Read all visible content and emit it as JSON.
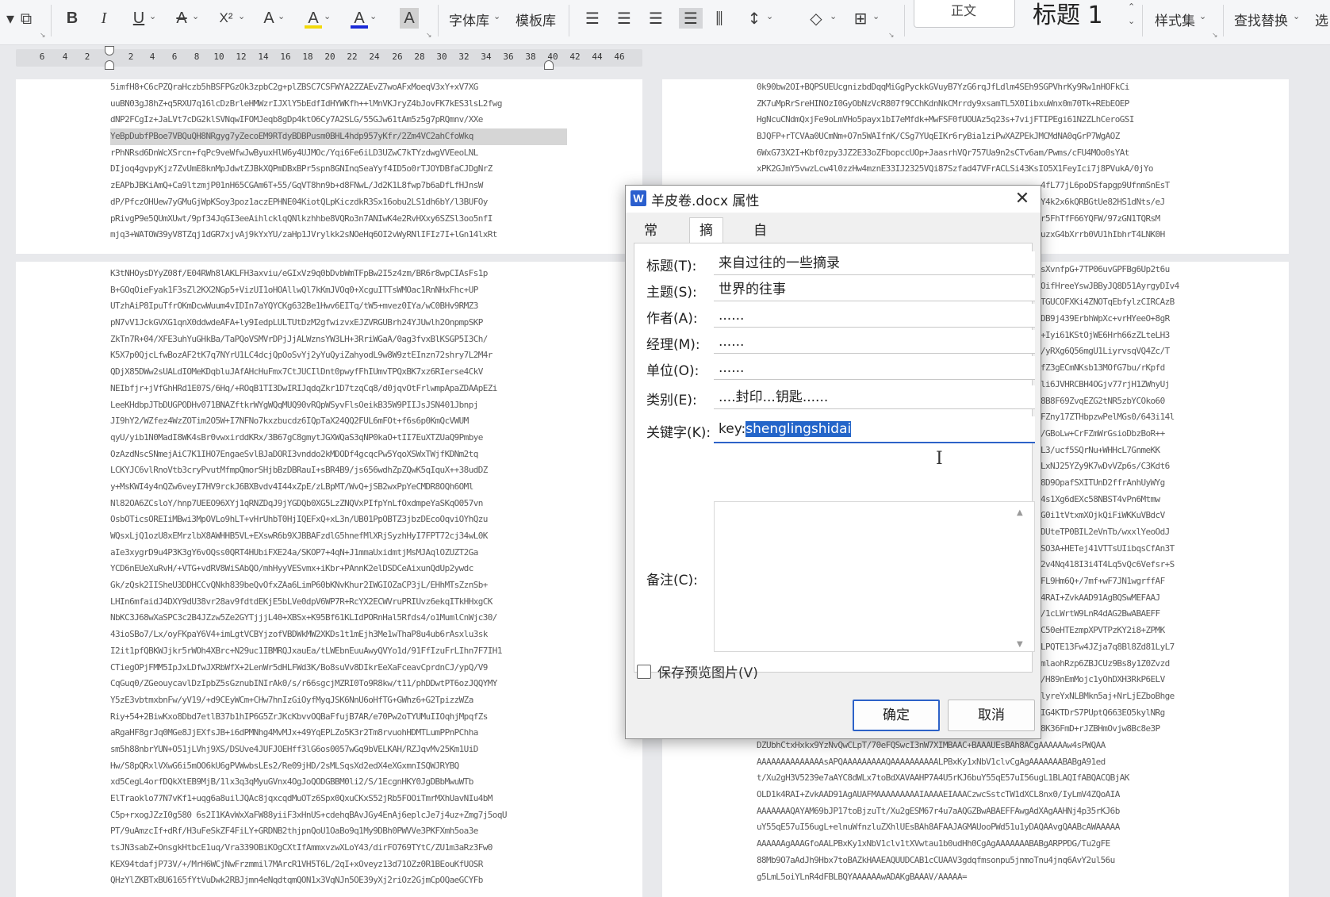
{
  "ribbon": {
    "bold": "B",
    "italic": "I",
    "underline": "U",
    "strikethrough": "A",
    "superscript": "X²",
    "font_effect": "A",
    "highlight": "A",
    "font_color": "A",
    "char_shading": "A",
    "font_library": "字体库",
    "template_library": "模板库",
    "style_normal": "正文",
    "style_heading": "标题 1",
    "style_set": "样式集",
    "find_replace": "查找替换",
    "select": "选"
  },
  "ruler": {
    "ticks": [
      "6",
      "4",
      "2",
      "2",
      "4",
      "6",
      "8",
      "10",
      "12",
      "14",
      "16",
      "18",
      "20",
      "22",
      "24",
      "26",
      "28",
      "30",
      "32",
      "34",
      "36",
      "38",
      "40",
      "42",
      "44",
      "46"
    ]
  },
  "left_page_top": [
    "5imfH8+C6cPZQraHczb5hBSFPGzOk3zpbC2g+plZBSC7CSFWYA2ZZAEvZ7woAFxMoeqV3xY+xV7XG",
    "uuBN03gJ8hZ+q5RXU7q16lcDzBrleHMWzrIJXlY5bEdfIdHYWKfh++lMnVKJryZ4bJovFK7kES3lsL2fwg",
    "dNP2FCgIz+JaLVt7cDG2klSVNqwIFOMJeqb8gDp4ktO6Cy7A2SLG/55GJw61tAm5z5g7pRQmnv/XXe",
    "YeBpDubfPBoe7VBQuQH8NRgyg7yZecoEM9RTdyBDBPusm0BHL4hdp957yKfr/2Zm4VC2ahCfoWkq",
    "rPhNRsd6DnWcXSrcn+fqPc9veWfwJwByuxHlW6y4UJMOc/Yqi6Fe6iLD3UZwC7kTYzdwgVVEeoLNL",
    "DIjoq4gvpyKjz7ZvUmE8knMpJdwtZJBkXQPmDBxBPr5spn8GNInqSeaYyf4ID5o0rTJOYDBfaCJDgNrZ",
    "zEAPbJBKiAmQ+Ca9ltzmjP01nH65CGAm6T+55/GqVT8hn9b+d8FNwL/Jd2K1L8fwp7b6aDfLfHJnsW",
    "dP/PfczOHUew7yGMuGjWpKSoy3poz1aczEPHNE04KiotQLpKiczdkR3Sx16obu2LS1dh6bY/l3BUFOy",
    "pRivgP9e5QUmXUwt/9pf34JqGI3eeAihlcklqQNlkzhhbe8VQRo3n7ANIwK4e2RvHXxy6SZSl3oo5nfI",
    "mjq3+WATOW39yV8TZqj1dGR7xjvAj9kYxYU/zaHp1JVrylkk2sNOeHq6OI2vWyRNlIFIz7I+lGn14lxRt"
  ],
  "left_page_bottom": [
    "K3tNHOysDYyZ08f/E04RWh8lAKLFH3axviu/eGIxVz9q0bDvbWmTFpBw2I5z4zm/BR6r8wpCIAsFs1p",
    "B+GOqOieFyak1F3sZl2KX2NGp5+VizUI1oHOAllwQl7kKmJVOq0+XcguITTsWMOac1RnNHxFhc+UP",
    "UTzhAiP8IpuTfrOKmDcwWuum4vIDIn7aYQYCKg632Be1Hwv6EITq/tW5+mvez0IYa/wC0BHv9RMZ3",
    "pN7vV1JckGVXG1qnX0ddwdeAFA+ly9IedpLULTUtDzM2gfwizvxEJZVRGUBrh24YJUwlh2OnpmpSKP",
    "ZkTn7R+04/XFE3uhYuGHkBa/TaPQoVSMVrDPjJjALWznsYW3LH+3RriWGaA/0ag3fvxBlKSGP5I3Ch/",
    "K5X7p0QjcLfwBozAF2tK7q7NYrU1LC4dcjQpOoSvYj2yYuQyiZahyodL9w8W9ztEInzn72shry7L2M4r",
    "QDjX85DWw2sUALdIOMeKDqbluJAfAHcHuFmx7CtJUCIlDnt0pwyfFhIUmvTPQxBK7xz6RIerse4CkV",
    "NEIbfjr+jVfGhHRd1E07S/6Hq/+ROqB1TI3DwIRIJqdqZkr1D7tzqCq8/d0jqvOtFrlwmpApaZDAApEZi",
    "LeeKHdbpJTbDUGPODHv071BNAZftkrWYgWQqMUQ90vRQpWSyvFlsOeikB35W9PIIJsJSN401Jbnpj",
    "JI9hY2/WZfez4WzZOTim2O5W+I7NFNo7kxzbucdz6IQpTaX24QQ2FUL6mFOt+f6s6p0KmQcVWUM",
    "qyU/yib1N0MadI8WK4sBr0vwxirddKRx/3B67gC8gmytJGXWQaS3qNP0kaO+tII7EuXTZUaQ9Pmbye",
    "OzAzdNscSNmejAiC7K1IHO7EngaeSvlBJaDORI3vnddo2kMDODf4gcqcPw5YqoXSWxTWjfKDNm2tq",
    "LCKYJC6vlRnoVtb3cryPvutMfmpQmorSHjbBzDBRauI+sBR4B9/js656wdhZpZQwK5qIquX++38udDZ",
    "y+MsKWI4y4nQZw6veyI7HV9rckJ6BXBvdv4I44xZpE/zLBpMT/WvQ+jSB2wxPpYeCMDR8OQh6OMl",
    "Nl82OA6ZCsloY/hnp7UEEO96XYj1qRNZDqJ9jYGDQb0XG5LzZNQVxPIfpYnLfOxdmpeYaSKqO057vn",
    "OsbOTicsOREIiMBwi3MpOVLo9hLT+vHrUhbT0HjIQEFxQ+xL3n/UB01PpOBTZ3jbzDEcoOqviOYhQzu",
    "WQsxLjQ1ozU8xEMrzlbX8AWHHB5VL+EXswR6b9XJBBAFzdlG5hnefMlXRjSyzhHyI7FPT72cj34wL0K",
    "aIe3xygrD9u4P3K3gY6vOQss0QRT4HUbiFXE24a/SKOP7+4qN+J1mmaUxidmtjMsMJAqlOZUZT2Ga",
    "YCD6nEUeXuRvH/+VTG+vdRV8WiSAbQO/mhHyyVESvmx+iKbr+PAnnK2elDSDCeAixunQdUp2ywdc",
    "Gk/zQsk2IISheU3DDHCCvQNkh839beQvOfxZAa6LimP60bKNvKhur2IWGIOZaCP3jL/EHhMTsZznSb+",
    "LHIn6mfaidJ4DXY9dU38vr28av9fdtdEKjE5bLVe0dpV6WP7R+RcYX2ECWVruPRIUvz6ekqITkHHxgCK",
    "NbKC3J68wXaSPC3c2B4JZzw5Ze2GYTjjjL40+XBSx+K95Bf61KLIdPORnHal5Rfds4/o1MumlCnWjc30/",
    "43ioSBo7/Lx/oyFKpaY6V4+imLgtVCBYjzofVBDWkMW2XKDs1t1mEjh3Me1wThaP8u4ub6rAsxlu3sk",
    "I2it1pfQBKWJjkr5rWOh4XBrc+N29uc1IBMRQJxauEa/tLWEbnEuuAwyQVYo1d/91FfIzuFrLIhn7F7IH1",
    "CTiegOPjFMM5IpJxLDfwJXRbWfX+2LenWr5dHLFWd3K/Bo8suVv8DIkrEeXaFceavCprdnCJ/ypQ/V9",
    "CqGuq0/ZGeouycavlDzIpbZ5sGznubINIrAk0/s/r66sgcjMZRI0To9R8kw/t11/phDDwtPT6ozJQQYMY",
    "Y5zE3vbtmxbnFw/yV19/+d9CEyWCm+CHw7hnIzGiOyfMyqJSK6NnU6oHfTG+GWhz6+G2TpizzWZa",
    "Riy+54+2BiwKxo8Dbd7etlB37b1hIP6G5ZrJKcKbvvOQBaFfujB7AR/e70Pw2oTYUMuIIOqhjMpqfZs",
    "aRgaHF8grJq0MGe8JjEXfsJB+i6dPMNhg4MvMJx+49YqEPLZo5K3r2Tm8rvuohHDMTLumPPnPChha",
    "sm5h88nbrYUN+O51jLVhj9XS/DSUve4JUFJOEHff3lG6os0057wGq9bVELKAH/RZJqvMv25Km1UiD",
    "Hw/S8pQRxlVXwG6i5mOO6kU6gPVWwbsLEs2/Re09jHD/2sMLSqsXd2edX4eXGxmnISQWJRYBQ",
    "xd5CegL4orfDQkXtEB9MjB/1lx3q3qMyuGVnx4OgJoQODGBBM0li2/S/1EcgnHKY0JgDBbMwuWTb",
    "ElTraoklo77N7vKf1+uqg6a8uilJQAc8jqxcqdMuOTz6Spx0QxuCKxS52jRb5FOOiTmrMXhUavNIu4bM",
    "C5p+rxogJZzI0g580 6s2I1KAvWxXaFW88yiiF3xHnUS+cdehqBAvJGy4EnAj6eplcJe7j4uz+Zmg7j5oqU",
    "PT/9uAmzcIf+dRf/H3uFeSkZF4FiLY+GRDNB2thjpnQoU1OaBo9q1My9DBh0PWVVe3PKFXmh5oa3e",
    "tsJN3sabZ+OnsgkHtbcE1uq/Vra339OBiKOgCXtIfAmmxvzwXLoY43/dirFO769TYtC/ZU1m3aRz3Fw0",
    "KEX94tdafjP73V/+/MrH6WCjNwFrzmmil7MArcR1VH5T6L/2qI+xOveyz13d71OZz0R1BEouKfUOSR",
    "QHzYlZKBTxBU6165fYtVuDwk2RBJjmn4eNqdtqmQON1x3VqNJn5OE39yXj2riOz2GjmCpOQaeGCYFb"
  ],
  "right_page_top": [
    "0k90bw2OI+BQPSUEUcgnizbdDqqMiGgPyckkGVuyB7YzG6rqJfLdlm4SEh9SGPVhrKy9Rw1nHOFkCi",
    "ZK7uMpRrSreHINOzI0GyObNzVcR807f9CChKdnNkCMrrdy9xsamTL5X0IibxuWnx0m70Tk+REbEOEP",
    "HgNcuCNdmQxjFe9oLmVHo5payx1bI7eMfdk+MwFSF0fUOUAz5q23s+7vijFTIPEgi61N2ZLhCeroGSI",
    "BJQFP+rTCVAa0UCmNm+O7n5WAIfnK/CSg7YUqEIKr6ryBia1ziPwXAZPEkJMCMdNA0qGrP7WgAOZ",
    "6WxG73X2I+Kbf0zpy3JZ2E33oZFbopccUOp+JaasrhVQr757Ua9n2sCTv6am/Pwms/cFU4MOo0sYAt",
    "xPK2GJmY5vwzLcw4l0zzHw4mznE33IJ2325VQi87Szfad47VFrACLSi43KsIO5X1FeyIci7j8PVukA/0jYo",
    "4fL77jL6poDSfapgp9UfnmSnEsT",
    "Y4k2x6kQRBGtUe82HS1dNts/eJ",
    "r5FhTfF66YQFW/97zGN1TQRsM",
    "uzxG4bXrrb0VU1hIbhrT4LNK0H"
  ],
  "right_page_middle": [
    "sXvnfpG+7TP06uvGPFBg6Up2t6u",
    "OifHreeYswJBByJQ8D51AyrgyDIv4",
    "TGUCOFXKi4ZNOTqEbfylzCIRCAzB",
    "DB9j439ErbhWpXc+vrHYeeO+8gR",
    "+Iyi61KStOjWE6Hrh66zZLteLH3",
    "/yRXg6Q56mgU1LiyrvsqVQ4Zc/T",
    "fZ3gECmNKsb13MOfG7bu/rKpfd",
    "li6JVHRCBH4OGjv77rjH1ZWhyUj",
    "8B8F69ZvqEZG2tNR5zbYCOko60",
    "FZny17ZTHbpzwPelMGs0/643i14l",
    "/GBoLw+CrFZmWrGsioDbzBoR++",
    "L3/ucf5SQrNu+WHHcL7GnmeKK",
    "LxNJ25YZy9K7wDvVZp6s/C3Kdt6",
    "8D9OpafSXITUnD2ffrAnhUyWYg",
    "4s1Xg6dEXc58NBST4vPn6Mtmw",
    "G0i1tVtxmXOjkQiFiWKKuVBdcV",
    "DUteTP0BIL2eVnTb/wxxlYeoOdJ",
    "SO3A+HETej41VTTsUIibqsCfAn3T",
    "2v4Nq418I3i4T4Lq5vQc6Vefsr+S",
    "FL9Hm6Q+/7mf+wF7JN1wgrffAF",
    "4RAI+ZvkAAD91AgBQSwMEFAAJ",
    "/1cLWrtW9LnR4dAG2BwABAEFF",
    "C50eHTEzmpXPVTPzKY2i8+ZPMK",
    "LPQTE13Fw4JZja7q8Bl8Zd81LyL7",
    "mlaohRzp6ZBJCUz9Bs8y1Z0Zvzd",
    "/H89nEmMojc1yOhDXH3RkP6ELV",
    "lyreYxNLBMkn5aj+NrLjEZboBhge",
    "IG4KTDrS7PUptQ663EO5kylNRg",
    "8K36FmD+rJZBHmOvjw8Bc8e3P"
  ],
  "right_page_bottom": [
    "DZUbhCtxHxkx9YzNvQwCLpT/70eFQSwcI3nW7XIMBAAC+BAAAUEsBAh8ACgAAAAAAw4sPWQAA",
    "AAAAAAAAAAAAAAsAPQAAAAAAAAAQAAAAAAAAAALPBxKy1xNbV1clvCgAgAAAAAAABABgA91ed",
    "t/Xu2gH3V5239e7aAYC8dWLx7toBdXAVAAHP7A4U5rKJ6buY55qE57uI56ugL1BLAQIfABQACQBjAK",
    "OLD1k4RAI+ZvkAAD91AgAUAFMAAAAAAAAAIAAAAEIAAACzwcSstcTW1dXCL8nx0/IyLmV4ZQoAIA",
    "AAAAAAAQAYAM69bJP17toBjzuTt/Xu2gESM67r4u7aAQGZBwABAEFFAwgAdXAgAAHNj4p35rKJ6b",
    "uY55qE57uI56ugL+elnuWfnzluZXhlUEsBAh8AFAAJAGMAUooPWd51u1yDAQAAvgQAABcAWAAAAA",
    "AAAAAAgAAAGfoAALPBxKy1xNbV1clv1tXVwtau1b0udHh0CgAgAAAAAAABABgARPPDG/Tu2gFE",
    "88Mb9O7aAdJh9Hbx7toBAZkHAAEAQUUDCAB1cCUAAV3gdqfmsonpu5jnmoTnu4jnq6AvY2ul56u",
    "g5LmL5oiYLnR4dFBLBQYAAAAAAwADAKgBAAAV/AAAAA="
  ],
  "dialog": {
    "title": "羊皮卷.docx 属性",
    "close_glyph": "✕",
    "app_icon": "W",
    "tabs": [
      "常规",
      "摘要",
      "自定义"
    ],
    "fields": {
      "title": {
        "label": "标题(T):",
        "value": "来自过往的一些摘录"
      },
      "subject": {
        "label": "主题(S):",
        "value": "世界的往事"
      },
      "author": {
        "label": "作者(A):",
        "value": "......"
      },
      "manager": {
        "label": "经理(M):",
        "value": "......"
      },
      "company": {
        "label": "单位(O):",
        "value": "......"
      },
      "category": {
        "label": "类别(E):",
        "value": "....封印...钥匙......"
      },
      "keywords": {
        "label": "关键字(K):",
        "value_prefix": "key:",
        "value_selected": "shenglingshidai"
      },
      "comments": {
        "label": "备注(C):",
        "value": ""
      }
    },
    "save_preview_label": "保存预览图片(V)",
    "save_preview_checked": false,
    "ok_label": "确定",
    "cancel_label": "取消"
  }
}
